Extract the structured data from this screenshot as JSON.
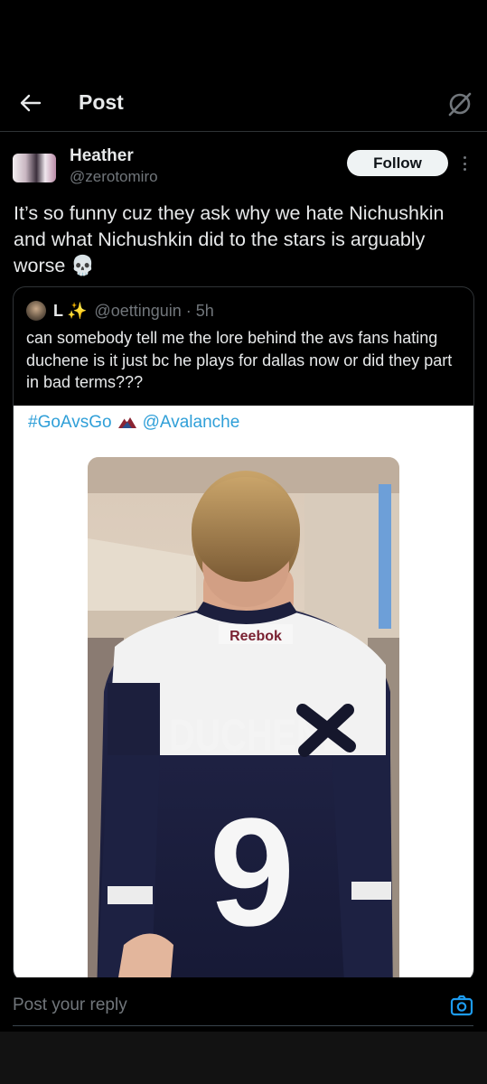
{
  "header": {
    "title": "Post",
    "back_icon": "arrow-left-icon",
    "right_icon": "no-sign-icon"
  },
  "author": {
    "name": "Heather",
    "handle": "@zerotomiro",
    "follow_label": "Follow",
    "more_icon": "vertical-dots-icon"
  },
  "post": {
    "text": "It’s so funny cuz they ask why we hate Nichushkin and what Nichushkin did to the stars is arguably worse 💀"
  },
  "quote": {
    "name": "L",
    "sparkle": "✨",
    "handle_time": "@oettinguin · 5h",
    "text": "can somebody tell me the lore behind the avs fans hating duchene is it just bc he plays for dallas now or did they part in bad terms???",
    "embed": {
      "hashtag": "#GoAvsGo",
      "mention": "@Avalanche",
      "jersey_brand": "Reebok",
      "jersey_name": "DUCHENE",
      "jersey_number": "9"
    }
  },
  "reply": {
    "placeholder": "Post your reply",
    "camera_icon": "camera-icon"
  },
  "colors": {
    "background": "#000000",
    "text_primary": "#e7e9ea",
    "text_secondary": "#71767b",
    "link": "#1d9bf0",
    "border": "#2f3336"
  }
}
